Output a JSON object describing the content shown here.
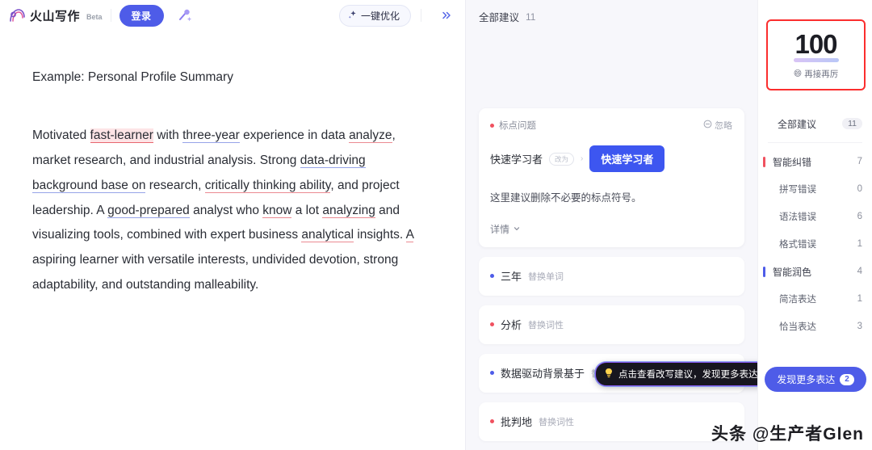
{
  "header": {
    "brand_name": "火山写作",
    "beta_tag": "Beta",
    "login_label": "登录",
    "magic_icon": "magic-wand-icon",
    "optimize_label": "一键优化",
    "optimize_icon": "sparkle-icon",
    "collapse_icon": "double-chevron-right-icon"
  },
  "document": {
    "title": "Example: Personal Profile Summary",
    "paragraph_segments": [
      {
        "text": "Motivated ",
        "mark": "none"
      },
      {
        "text": "fast-learner",
        "mark": "highlight-red"
      },
      {
        "text": " with ",
        "mark": "none"
      },
      {
        "text": "three-year",
        "mark": "underline-blue"
      },
      {
        "text": " experience in data ",
        "mark": "none"
      },
      {
        "text": "analyze",
        "mark": "underline-red"
      },
      {
        "text": ", market research, and industrial analysis. Strong ",
        "mark": "none"
      },
      {
        "text": "data-driving background base on",
        "mark": "underline-blue"
      },
      {
        "text": " research, ",
        "mark": "none"
      },
      {
        "text": "critically thinking ability",
        "mark": "underline-red"
      },
      {
        "text": ", and project leadership. A ",
        "mark": "none"
      },
      {
        "text": "good-prepared",
        "mark": "underline-blue"
      },
      {
        "text": " analyst who ",
        "mark": "none"
      },
      {
        "text": "know",
        "mark": "underline-red"
      },
      {
        "text": " a lot ",
        "mark": "none"
      },
      {
        "text": "analyzing",
        "mark": "underline-red"
      },
      {
        "text": " and visualizing tools, combined with expert business ",
        "mark": "none"
      },
      {
        "text": "analytical",
        "mark": "underline-red"
      },
      {
        "text": " insights. ",
        "mark": "none"
      },
      {
        "text": "A",
        "mark": "underline-red"
      },
      {
        "text": " aspiring learner with versatile interests, undivided devotion, strong adaptability, and outstanding malleability.",
        "mark": "none"
      }
    ]
  },
  "suggestions_panel": {
    "header_label": "全部建议",
    "header_count": "11",
    "card": {
      "tag": "标点问题",
      "ignore_label": "忽略",
      "ignore_icon": "circle-minus-icon",
      "original": "快速学习者",
      "change_pill": "改为",
      "arrow_icon": "arrow-right-icon",
      "replacement": "快速学习者",
      "description": "这里建议删除不必要的标点符号。",
      "detail_label": "详情",
      "detail_icon": "chevron-down-icon"
    },
    "items": [
      {
        "word": "三年",
        "type": "替换单词",
        "dot": "blue"
      },
      {
        "word": "分析",
        "type": "替换词性",
        "dot": "red"
      },
      {
        "word": "数据驱动背景基于",
        "type": "替换词组",
        "dot": "blue"
      },
      {
        "word": "批判地",
        "type": "替换词性",
        "dot": "red"
      }
    ]
  },
  "tooltip": {
    "icon": "lightbulb-icon",
    "text": "点击查看改写建议，发现更多表达"
  },
  "score_panel": {
    "score": "100",
    "sub_emoji": "😄",
    "sub_label": "再接再厉",
    "border_color": "#fb2e2e"
  },
  "categories": {
    "all": {
      "label": "全部建议",
      "count": "11"
    },
    "groups": [
      {
        "label": "智能纠错",
        "count": "7",
        "bar": "red",
        "children": [
          {
            "label": "拼写错误",
            "count": "0"
          },
          {
            "label": "语法错误",
            "count": "6"
          },
          {
            "label": "格式错误",
            "count": "1"
          }
        ]
      },
      {
        "label": "智能润色",
        "count": "4",
        "bar": "blue",
        "children": [
          {
            "label": "简洁表达",
            "count": "1"
          },
          {
            "label": "恰当表达",
            "count": "3"
          }
        ]
      }
    ]
  },
  "discover": {
    "label": "发现更多表达",
    "badge": "2"
  },
  "watermark": {
    "text": "头条 @生产者Glen"
  }
}
